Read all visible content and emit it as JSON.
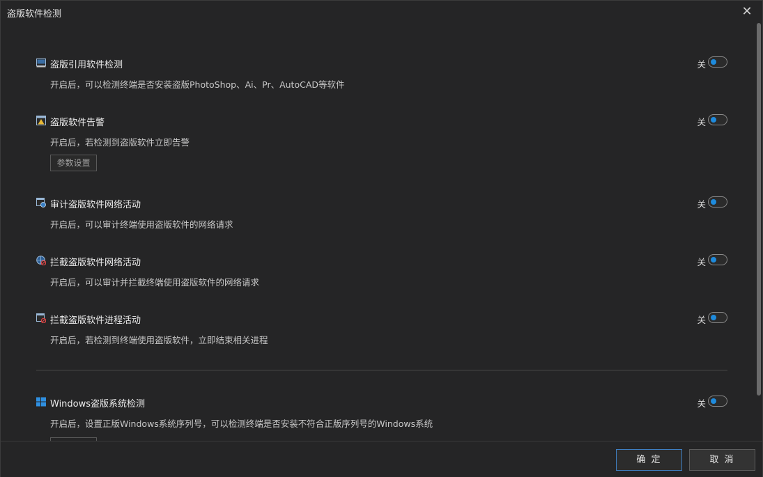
{
  "dialog": {
    "title": "盗版软件检测"
  },
  "sections": [
    {
      "title": "盗版引用软件检测",
      "desc": "开启后，可以检测终端是否安装盗版PhotoShop、Ai、Pr、AutoCAD等软件",
      "toggle_label": "关"
    },
    {
      "title": "盗版软件告警",
      "desc": "开启后，若检测到盗版软件立即告警",
      "toggle_label": "关",
      "button": "参数设置"
    },
    {
      "title": "审计盗版软件网络活动",
      "desc": "开启后，可以审计终端使用盗版软件的网络请求",
      "toggle_label": "关"
    },
    {
      "title": "拦截盗版软件网络活动",
      "desc": "开启后，可以审计并拦截终端使用盗版软件的网络请求",
      "toggle_label": "关"
    },
    {
      "title": "拦截盗版软件进程活动",
      "desc": "开启后，若检测到终端使用盗版软件，立即结束相关进程",
      "toggle_label": "关"
    },
    {
      "title": "Windows盗版系统检测",
      "desc": "开启后，设置正版Windows系统序列号，可以检测终端是否安装不符合正版序列号的Windows系统",
      "toggle_label": "关"
    }
  ],
  "footer": {
    "ok_label": "确 定",
    "cancel_label": "取 消"
  },
  "colors": {
    "accent": "#1e8bdd",
    "background": "#252526"
  }
}
